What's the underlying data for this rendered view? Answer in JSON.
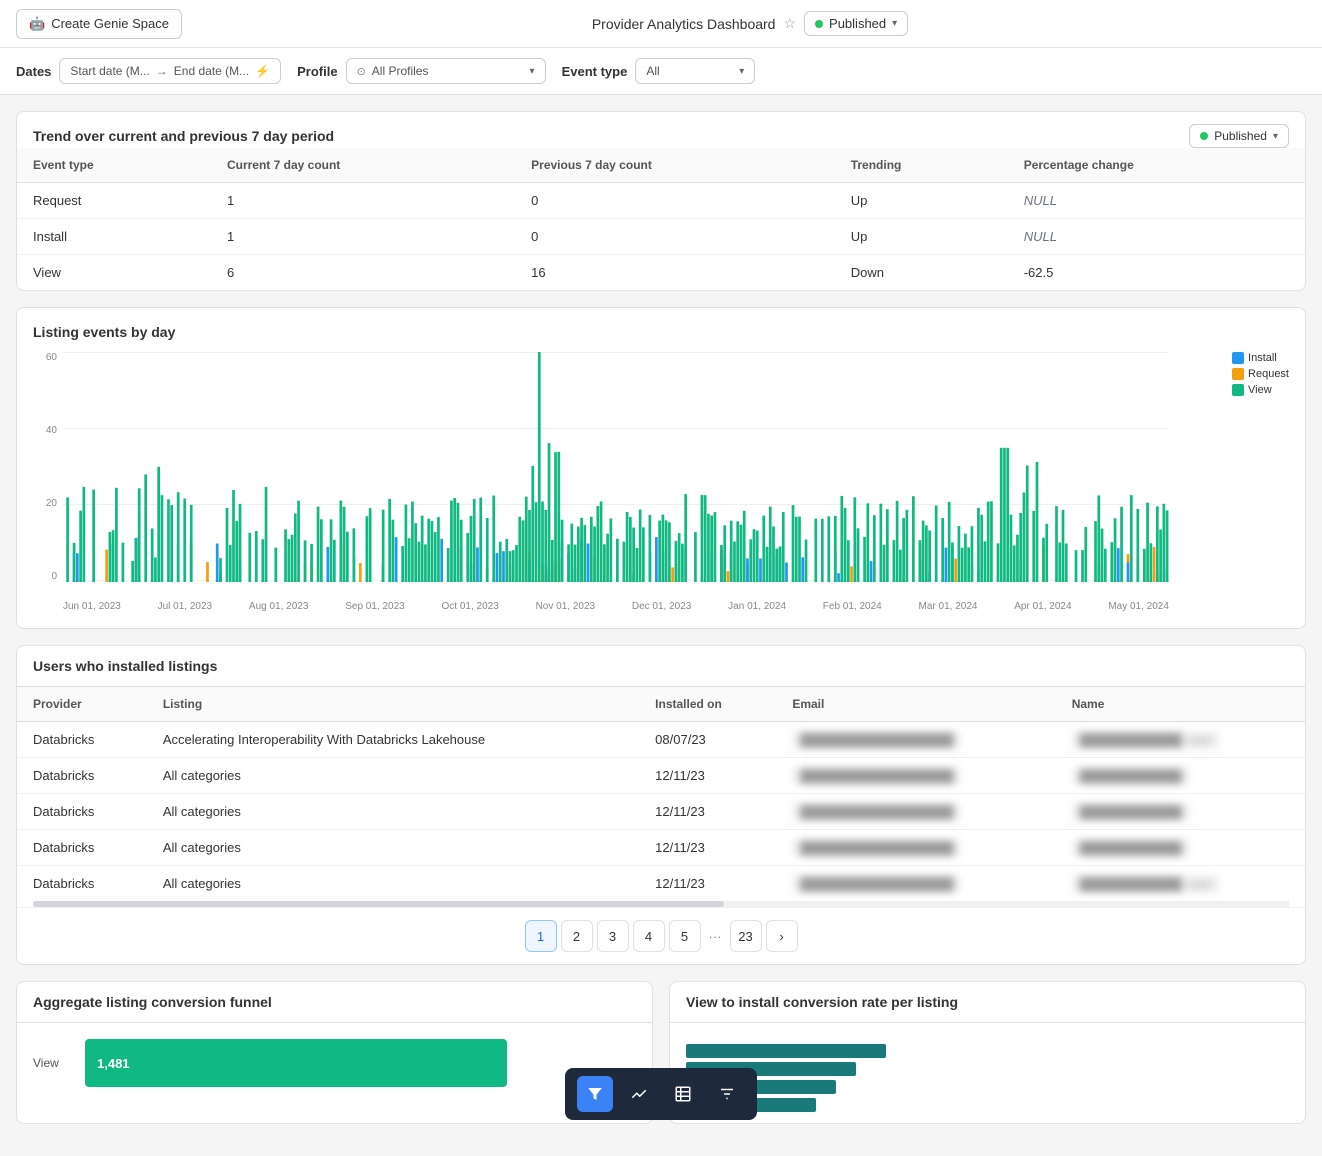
{
  "header": {
    "create_btn": "Create Genie Space",
    "title": "Provider Analytics Dashboard",
    "published": "Published"
  },
  "filters": {
    "dates_label": "Dates",
    "start_placeholder": "Start date (M...",
    "end_placeholder": "End date (M...",
    "profile_label": "Profile",
    "all_profiles": "All Profiles",
    "event_type_label": "Event type",
    "event_type_value": "All"
  },
  "trend_table": {
    "title": "Trend over current and previous 7 day period",
    "published_label": "Published",
    "columns": [
      "Event type",
      "Current 7 day count",
      "Previous 7 day count",
      "Trending",
      "Percentage change"
    ],
    "rows": [
      {
        "event_type": "Request",
        "current": "1",
        "previous": "0",
        "trending": "Up",
        "pct_change": "NULL"
      },
      {
        "event_type": "Install",
        "current": "1",
        "previous": "0",
        "trending": "Up",
        "pct_change": "NULL"
      },
      {
        "event_type": "View",
        "current": "6",
        "previous": "16",
        "trending": "Down",
        "pct_change": "-62.5"
      }
    ]
  },
  "chart": {
    "title": "Listing events by day",
    "y_labels": [
      "60",
      "40",
      "20",
      "0"
    ],
    "x_labels": [
      "Jun 01, 2023",
      "Jul 01, 2023",
      "Aug 01, 2023",
      "Sep 01, 2023",
      "Oct 01, 2023",
      "Nov 01, 2023",
      "Dec 01, 2023",
      "Jan 01, 2024",
      "Feb 01, 2024",
      "Mar 01, 2024",
      "Apr 01, 2024",
      "May 01, 2024"
    ],
    "legend": [
      {
        "label": "Install",
        "color": "#2196f3"
      },
      {
        "label": "Request",
        "color": "#f59e0b"
      },
      {
        "label": "View",
        "color": "#10b981"
      }
    ]
  },
  "installs_table": {
    "title": "Users who installed listings",
    "columns": [
      "Provider",
      "Listing",
      "Installed on",
      "Email",
      "Name"
    ],
    "rows": [
      {
        "provider": "Databricks",
        "listing": "Accelerating Interoperability With Databricks Lakehouse",
        "installed_on": "08/07/23",
        "email": "████████████████",
        "name": "███████████████ .com"
      },
      {
        "provider": "Databricks",
        "listing": "All categories",
        "installed_on": "12/11/23",
        "email": "████████████████████",
        "name": "█████████████"
      },
      {
        "provider": "Databricks",
        "listing": "All categories",
        "installed_on": "12/11/23",
        "email": "████████████████████",
        "name": "█████████████"
      },
      {
        "provider": "Databricks",
        "listing": "All categories",
        "installed_on": "12/11/23",
        "email": "████████████████████",
        "name": "█████████████████████"
      },
      {
        "provider": "Databricks",
        "listing": "All categories",
        "installed_on": "12/11/23",
        "email": "████████████",
        "name": "██████████ .com"
      }
    ],
    "pagination": {
      "current": 1,
      "pages": [
        "1",
        "2",
        "3",
        "4",
        "5",
        "...",
        "23"
      ],
      "next_label": "›"
    }
  },
  "funnel": {
    "title": "Aggregate listing conversion funnel",
    "rows": [
      {
        "label": "View",
        "value": "1,481",
        "width_pct": 60
      }
    ]
  },
  "conversion": {
    "title": "View to install conversion rate per listing"
  },
  "toolbar": {
    "buttons": [
      "filter",
      "chart-line",
      "table",
      "filter-alt"
    ]
  },
  "colors": {
    "install": "#2196f3",
    "request": "#f59e0b",
    "view": "#10b981",
    "published_green": "#22c55e"
  }
}
